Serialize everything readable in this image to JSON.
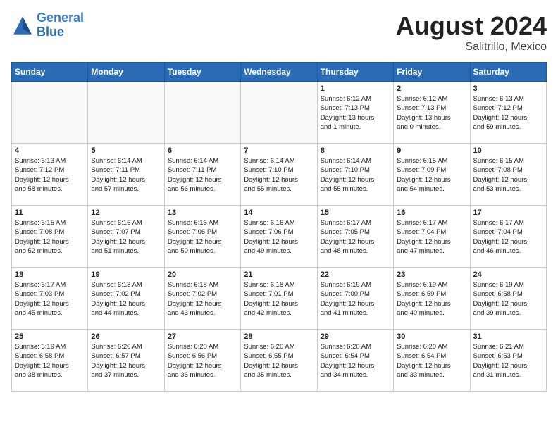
{
  "header": {
    "logo_line1": "General",
    "logo_line2": "Blue",
    "main_title": "August 2024",
    "subtitle": "Salitrillo, Mexico"
  },
  "days_of_week": [
    "Sunday",
    "Monday",
    "Tuesday",
    "Wednesday",
    "Thursday",
    "Friday",
    "Saturday"
  ],
  "weeks": [
    [
      {
        "day": "",
        "info": ""
      },
      {
        "day": "",
        "info": ""
      },
      {
        "day": "",
        "info": ""
      },
      {
        "day": "",
        "info": ""
      },
      {
        "day": "1",
        "info": "Sunrise: 6:12 AM\nSunset: 7:13 PM\nDaylight: 13 hours\nand 1 minute."
      },
      {
        "day": "2",
        "info": "Sunrise: 6:12 AM\nSunset: 7:13 PM\nDaylight: 13 hours\nand 0 minutes."
      },
      {
        "day": "3",
        "info": "Sunrise: 6:13 AM\nSunset: 7:12 PM\nDaylight: 12 hours\nand 59 minutes."
      }
    ],
    [
      {
        "day": "4",
        "info": "Sunrise: 6:13 AM\nSunset: 7:12 PM\nDaylight: 12 hours\nand 58 minutes."
      },
      {
        "day": "5",
        "info": "Sunrise: 6:14 AM\nSunset: 7:11 PM\nDaylight: 12 hours\nand 57 minutes."
      },
      {
        "day": "6",
        "info": "Sunrise: 6:14 AM\nSunset: 7:11 PM\nDaylight: 12 hours\nand 56 minutes."
      },
      {
        "day": "7",
        "info": "Sunrise: 6:14 AM\nSunset: 7:10 PM\nDaylight: 12 hours\nand 55 minutes."
      },
      {
        "day": "8",
        "info": "Sunrise: 6:14 AM\nSunset: 7:10 PM\nDaylight: 12 hours\nand 55 minutes."
      },
      {
        "day": "9",
        "info": "Sunrise: 6:15 AM\nSunset: 7:09 PM\nDaylight: 12 hours\nand 54 minutes."
      },
      {
        "day": "10",
        "info": "Sunrise: 6:15 AM\nSunset: 7:08 PM\nDaylight: 12 hours\nand 53 minutes."
      }
    ],
    [
      {
        "day": "11",
        "info": "Sunrise: 6:15 AM\nSunset: 7:08 PM\nDaylight: 12 hours\nand 52 minutes."
      },
      {
        "day": "12",
        "info": "Sunrise: 6:16 AM\nSunset: 7:07 PM\nDaylight: 12 hours\nand 51 minutes."
      },
      {
        "day": "13",
        "info": "Sunrise: 6:16 AM\nSunset: 7:06 PM\nDaylight: 12 hours\nand 50 minutes."
      },
      {
        "day": "14",
        "info": "Sunrise: 6:16 AM\nSunset: 7:06 PM\nDaylight: 12 hours\nand 49 minutes."
      },
      {
        "day": "15",
        "info": "Sunrise: 6:17 AM\nSunset: 7:05 PM\nDaylight: 12 hours\nand 48 minutes."
      },
      {
        "day": "16",
        "info": "Sunrise: 6:17 AM\nSunset: 7:04 PM\nDaylight: 12 hours\nand 47 minutes."
      },
      {
        "day": "17",
        "info": "Sunrise: 6:17 AM\nSunset: 7:04 PM\nDaylight: 12 hours\nand 46 minutes."
      }
    ],
    [
      {
        "day": "18",
        "info": "Sunrise: 6:17 AM\nSunset: 7:03 PM\nDaylight: 12 hours\nand 45 minutes."
      },
      {
        "day": "19",
        "info": "Sunrise: 6:18 AM\nSunset: 7:02 PM\nDaylight: 12 hours\nand 44 minutes."
      },
      {
        "day": "20",
        "info": "Sunrise: 6:18 AM\nSunset: 7:02 PM\nDaylight: 12 hours\nand 43 minutes."
      },
      {
        "day": "21",
        "info": "Sunrise: 6:18 AM\nSunset: 7:01 PM\nDaylight: 12 hours\nand 42 minutes."
      },
      {
        "day": "22",
        "info": "Sunrise: 6:19 AM\nSunset: 7:00 PM\nDaylight: 12 hours\nand 41 minutes."
      },
      {
        "day": "23",
        "info": "Sunrise: 6:19 AM\nSunset: 6:59 PM\nDaylight: 12 hours\nand 40 minutes."
      },
      {
        "day": "24",
        "info": "Sunrise: 6:19 AM\nSunset: 6:58 PM\nDaylight: 12 hours\nand 39 minutes."
      }
    ],
    [
      {
        "day": "25",
        "info": "Sunrise: 6:19 AM\nSunset: 6:58 PM\nDaylight: 12 hours\nand 38 minutes."
      },
      {
        "day": "26",
        "info": "Sunrise: 6:20 AM\nSunset: 6:57 PM\nDaylight: 12 hours\nand 37 minutes."
      },
      {
        "day": "27",
        "info": "Sunrise: 6:20 AM\nSunset: 6:56 PM\nDaylight: 12 hours\nand 36 minutes."
      },
      {
        "day": "28",
        "info": "Sunrise: 6:20 AM\nSunset: 6:55 PM\nDaylight: 12 hours\nand 35 minutes."
      },
      {
        "day": "29",
        "info": "Sunrise: 6:20 AM\nSunset: 6:54 PM\nDaylight: 12 hours\nand 34 minutes."
      },
      {
        "day": "30",
        "info": "Sunrise: 6:20 AM\nSunset: 6:54 PM\nDaylight: 12 hours\nand 33 minutes."
      },
      {
        "day": "31",
        "info": "Sunrise: 6:21 AM\nSunset: 6:53 PM\nDaylight: 12 hours\nand 31 minutes."
      }
    ]
  ]
}
